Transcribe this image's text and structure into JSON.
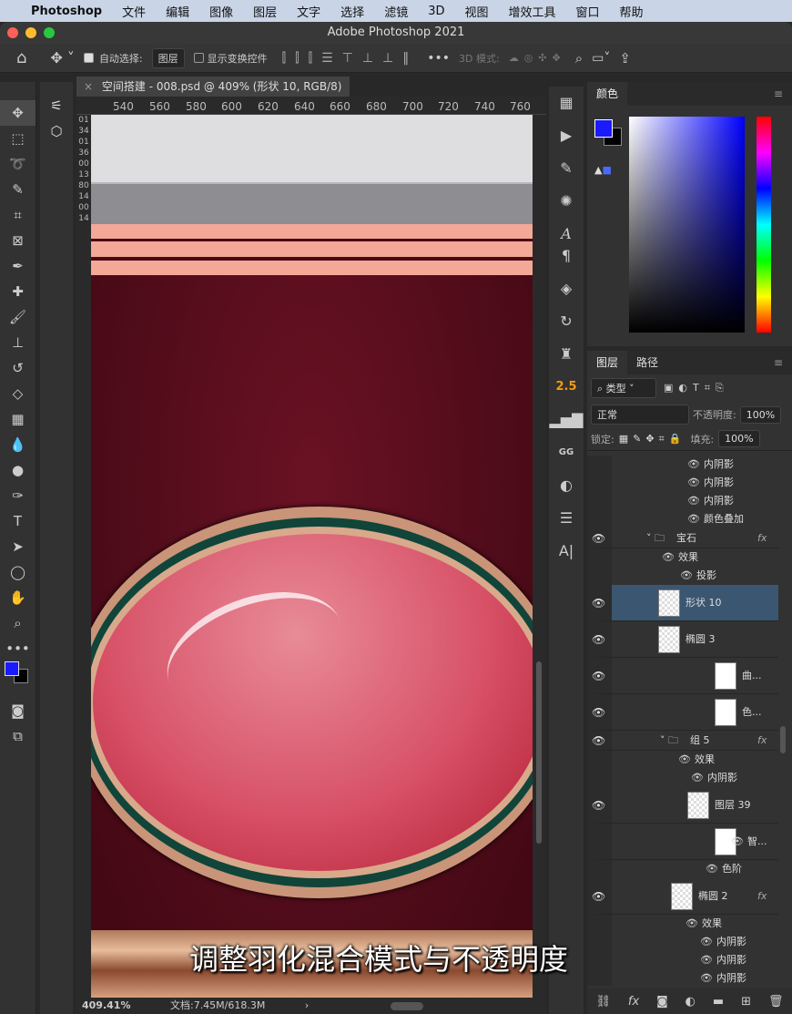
{
  "menubar": {
    "app": "Photoshop",
    "items": [
      "文件",
      "编辑",
      "图像",
      "图层",
      "文字",
      "选择",
      "滤镜",
      "3D",
      "视图",
      "增效工具",
      "窗口",
      "帮助"
    ]
  },
  "window": {
    "title": "Adobe Photoshop 2021"
  },
  "options": {
    "auto_select_label": "自动选择:",
    "auto_select_value": "图层",
    "show_transform_label": "显示变换控件",
    "mode3d_label": "3D 模式:"
  },
  "document": {
    "tab_title": "空间搭建 - 008.psd @ 409% (形状 10, RGB/8) *",
    "ruler_top": [
      "540",
      "560",
      "580",
      "600",
      "620",
      "640",
      "660",
      "680",
      "700",
      "720",
      "740",
      "760"
    ],
    "ruler_left": "01340136001380140014",
    "zoom": "409.41%",
    "doc_info": "文档:7.45M/618.3M"
  },
  "subtitle": "调整羽化混合模式与不透明度",
  "color_panel": {
    "title": "颜色",
    "foreground": "#1a1aff",
    "background": "#000000"
  },
  "layers_panel": {
    "tabs": [
      "图层",
      "路径"
    ],
    "filter": "类型",
    "blend_mode": "正常",
    "opacity_label": "不透明度:",
    "opacity": "100%",
    "lock_label": "锁定:",
    "fill_label": "填充:",
    "fill": "100%",
    "rows": [
      {
        "name": "内阴影",
        "kind": "effect"
      },
      {
        "name": "内阴影",
        "kind": "effect"
      },
      {
        "name": "内阴影",
        "kind": "effect"
      },
      {
        "name": "颜色叠加",
        "kind": "effect"
      },
      {
        "name": "宝石",
        "kind": "group"
      },
      {
        "name": "效果",
        "kind": "effect"
      },
      {
        "name": "投影",
        "kind": "effect"
      },
      {
        "name": "形状 10",
        "kind": "shape",
        "selected": true
      },
      {
        "name": "椭圆 3",
        "kind": "shape"
      },
      {
        "name": "曲...",
        "kind": "adjust"
      },
      {
        "name": "色...",
        "kind": "adjust"
      },
      {
        "name": "组 5",
        "kind": "group"
      },
      {
        "name": "效果",
        "kind": "effect"
      },
      {
        "name": "内阴影",
        "kind": "effect"
      },
      {
        "name": "图层 39",
        "kind": "smart"
      },
      {
        "name": "智...",
        "kind": "filter"
      },
      {
        "name": "色阶",
        "kind": "effect"
      },
      {
        "name": "椭圆 2",
        "kind": "shape"
      },
      {
        "name": "效果",
        "kind": "effect"
      },
      {
        "name": "内阴影",
        "kind": "effect"
      },
      {
        "name": "内阴影",
        "kind": "effect"
      },
      {
        "name": "内阴影",
        "kind": "effect"
      }
    ],
    "fx_label": "fx"
  },
  "right_icon_text": {
    "badge": "2.5",
    "gg": "GG"
  }
}
